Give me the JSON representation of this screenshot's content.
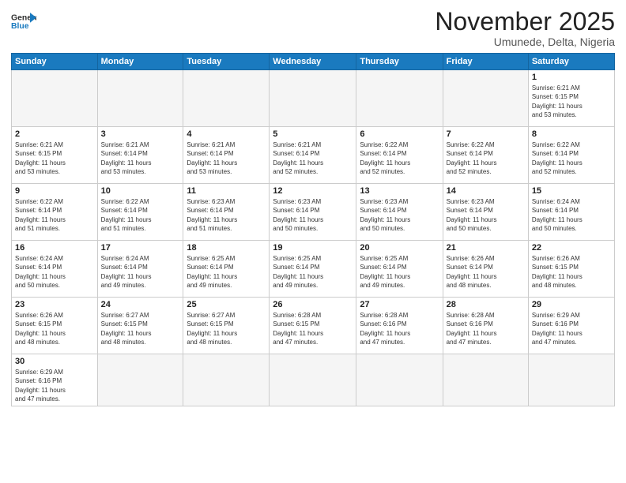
{
  "header": {
    "logo_general": "General",
    "logo_blue": "Blue",
    "month_title": "November 2025",
    "subtitle": "Umunede, Delta, Nigeria"
  },
  "weekdays": [
    "Sunday",
    "Monday",
    "Tuesday",
    "Wednesday",
    "Thursday",
    "Friday",
    "Saturday"
  ],
  "weeks": [
    [
      {
        "day": "",
        "info": ""
      },
      {
        "day": "",
        "info": ""
      },
      {
        "day": "",
        "info": ""
      },
      {
        "day": "",
        "info": ""
      },
      {
        "day": "",
        "info": ""
      },
      {
        "day": "",
        "info": ""
      },
      {
        "day": "1",
        "info": "Sunrise: 6:21 AM\nSunset: 6:15 PM\nDaylight: 11 hours\nand 53 minutes."
      }
    ],
    [
      {
        "day": "2",
        "info": "Sunrise: 6:21 AM\nSunset: 6:15 PM\nDaylight: 11 hours\nand 53 minutes."
      },
      {
        "day": "3",
        "info": "Sunrise: 6:21 AM\nSunset: 6:14 PM\nDaylight: 11 hours\nand 53 minutes."
      },
      {
        "day": "4",
        "info": "Sunrise: 6:21 AM\nSunset: 6:14 PM\nDaylight: 11 hours\nand 53 minutes."
      },
      {
        "day": "5",
        "info": "Sunrise: 6:21 AM\nSunset: 6:14 PM\nDaylight: 11 hours\nand 52 minutes."
      },
      {
        "day": "6",
        "info": "Sunrise: 6:22 AM\nSunset: 6:14 PM\nDaylight: 11 hours\nand 52 minutes."
      },
      {
        "day": "7",
        "info": "Sunrise: 6:22 AM\nSunset: 6:14 PM\nDaylight: 11 hours\nand 52 minutes."
      },
      {
        "day": "8",
        "info": "Sunrise: 6:22 AM\nSunset: 6:14 PM\nDaylight: 11 hours\nand 52 minutes."
      }
    ],
    [
      {
        "day": "9",
        "info": "Sunrise: 6:22 AM\nSunset: 6:14 PM\nDaylight: 11 hours\nand 51 minutes."
      },
      {
        "day": "10",
        "info": "Sunrise: 6:22 AM\nSunset: 6:14 PM\nDaylight: 11 hours\nand 51 minutes."
      },
      {
        "day": "11",
        "info": "Sunrise: 6:23 AM\nSunset: 6:14 PM\nDaylight: 11 hours\nand 51 minutes."
      },
      {
        "day": "12",
        "info": "Sunrise: 6:23 AM\nSunset: 6:14 PM\nDaylight: 11 hours\nand 50 minutes."
      },
      {
        "day": "13",
        "info": "Sunrise: 6:23 AM\nSunset: 6:14 PM\nDaylight: 11 hours\nand 50 minutes."
      },
      {
        "day": "14",
        "info": "Sunrise: 6:23 AM\nSunset: 6:14 PM\nDaylight: 11 hours\nand 50 minutes."
      },
      {
        "day": "15",
        "info": "Sunrise: 6:24 AM\nSunset: 6:14 PM\nDaylight: 11 hours\nand 50 minutes."
      }
    ],
    [
      {
        "day": "16",
        "info": "Sunrise: 6:24 AM\nSunset: 6:14 PM\nDaylight: 11 hours\nand 50 minutes."
      },
      {
        "day": "17",
        "info": "Sunrise: 6:24 AM\nSunset: 6:14 PM\nDaylight: 11 hours\nand 49 minutes."
      },
      {
        "day": "18",
        "info": "Sunrise: 6:25 AM\nSunset: 6:14 PM\nDaylight: 11 hours\nand 49 minutes."
      },
      {
        "day": "19",
        "info": "Sunrise: 6:25 AM\nSunset: 6:14 PM\nDaylight: 11 hours\nand 49 minutes."
      },
      {
        "day": "20",
        "info": "Sunrise: 6:25 AM\nSunset: 6:14 PM\nDaylight: 11 hours\nand 49 minutes."
      },
      {
        "day": "21",
        "info": "Sunrise: 6:26 AM\nSunset: 6:14 PM\nDaylight: 11 hours\nand 48 minutes."
      },
      {
        "day": "22",
        "info": "Sunrise: 6:26 AM\nSunset: 6:15 PM\nDaylight: 11 hours\nand 48 minutes."
      }
    ],
    [
      {
        "day": "23",
        "info": "Sunrise: 6:26 AM\nSunset: 6:15 PM\nDaylight: 11 hours\nand 48 minutes."
      },
      {
        "day": "24",
        "info": "Sunrise: 6:27 AM\nSunset: 6:15 PM\nDaylight: 11 hours\nand 48 minutes."
      },
      {
        "day": "25",
        "info": "Sunrise: 6:27 AM\nSunset: 6:15 PM\nDaylight: 11 hours\nand 48 minutes."
      },
      {
        "day": "26",
        "info": "Sunrise: 6:28 AM\nSunset: 6:15 PM\nDaylight: 11 hours\nand 47 minutes."
      },
      {
        "day": "27",
        "info": "Sunrise: 6:28 AM\nSunset: 6:16 PM\nDaylight: 11 hours\nand 47 minutes."
      },
      {
        "day": "28",
        "info": "Sunrise: 6:28 AM\nSunset: 6:16 PM\nDaylight: 11 hours\nand 47 minutes."
      },
      {
        "day": "29",
        "info": "Sunrise: 6:29 AM\nSunset: 6:16 PM\nDaylight: 11 hours\nand 47 minutes."
      }
    ],
    [
      {
        "day": "30",
        "info": "Sunrise: 6:29 AM\nSunset: 6:16 PM\nDaylight: 11 hours\nand 47 minutes."
      },
      {
        "day": "",
        "info": ""
      },
      {
        "day": "",
        "info": ""
      },
      {
        "day": "",
        "info": ""
      },
      {
        "day": "",
        "info": ""
      },
      {
        "day": "",
        "info": ""
      },
      {
        "day": "",
        "info": ""
      }
    ]
  ]
}
